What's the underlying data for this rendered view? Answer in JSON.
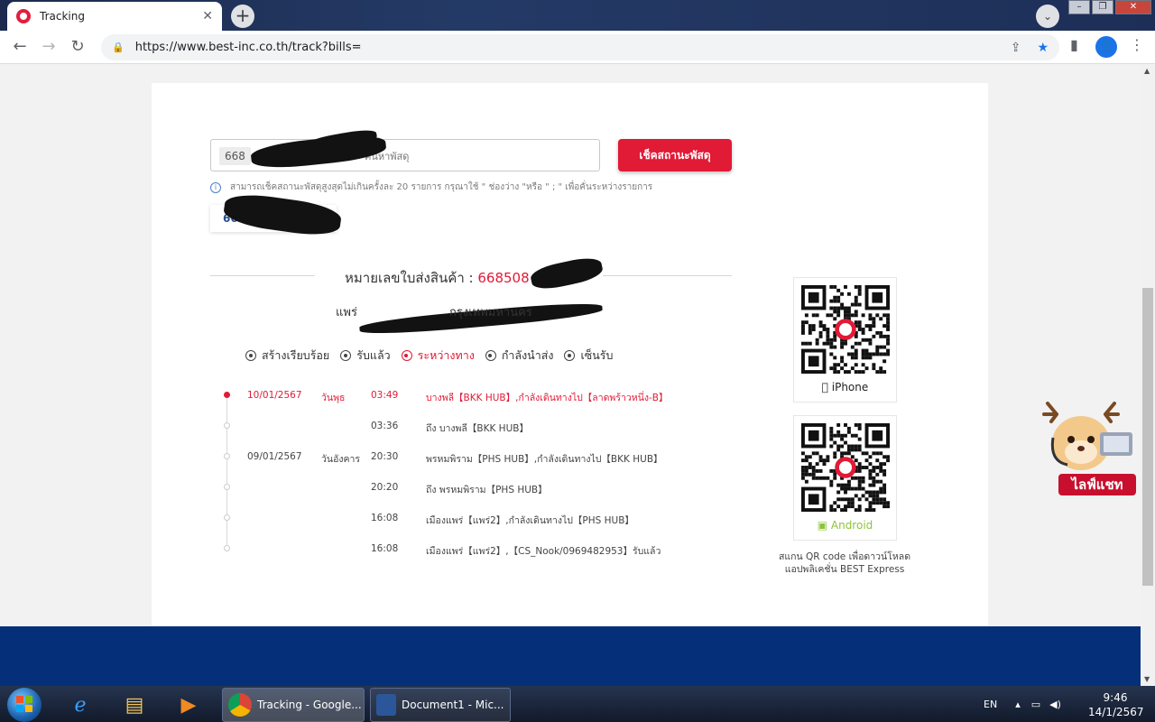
{
  "browser": {
    "tab_title": "Tracking",
    "url": "https://www.best-inc.co.th/track?bills="
  },
  "search": {
    "chip_text": "668",
    "placeholder": "ค้นหาพัสดุ",
    "button_label": "เช็คสถานะพัสดุ",
    "hint": "สามารถเช็คสถานะพัสดุสูงสุดไม่เกินครั้งละ 20 รายการ กรุณาใช้ \" ช่องว่าง \"หรือ \" ; \" เพื่อคั่นระหว่างรายการ",
    "history_text": "6685"
  },
  "shipment": {
    "waybill_label": "หมายเลขใบส่งสินค้า :",
    "waybill_number": "668508",
    "origin": "แพร่",
    "destination": "กรุงเทพมหานคร"
  },
  "steps": [
    {
      "label": "สร้างเรียบร้อย",
      "active": false
    },
    {
      "label": "รับแล้ว",
      "active": false
    },
    {
      "label": "ระหว่างทาง",
      "active": true
    },
    {
      "label": "กำลังนำส่ง",
      "active": false
    },
    {
      "label": "เซ็นรับ",
      "active": false
    }
  ],
  "events": [
    {
      "date": "10/01/2567",
      "day": "วันพุธ",
      "time": "03:49",
      "desc": "บางพลี【BKK HUB】,กำลังเดินทางไป【ลาดพร้าวหนึ่ง-B】"
    },
    {
      "date": "",
      "day": "",
      "time": "03:36",
      "desc": "ถึง บางพลี【BKK HUB】"
    },
    {
      "date": "09/01/2567",
      "day": "วันอังคาร",
      "time": "20:30",
      "desc": "พรหมพิราม【PHS HUB】,กำลังเดินทางไป【BKK HUB】"
    },
    {
      "date": "",
      "day": "",
      "time": "20:20",
      "desc": "ถึง พรหมพิราม【PHS HUB】"
    },
    {
      "date": "",
      "day": "",
      "time": "16:08",
      "desc": "เมืองแพร่【แพร่2】,กำลังเดินทางไป【PHS HUB】"
    },
    {
      "date": "",
      "day": "",
      "time": "16:08",
      "desc": "เมืองแพร่【แพร่2】,【CS_Nook/0969482953】รับแล้ว"
    }
  ],
  "apps": {
    "ios_label": "iPhone",
    "android_label": "Android",
    "caption_line1": "สแกน QR code เพื่อดาวน์โหลด",
    "caption_line2": "แอปพลิเคชั่น BEST Express"
  },
  "chat": {
    "label": "ไลฟ์แชท"
  },
  "taskbar": {
    "tasks": [
      "Tracking - Google...",
      "Document1 - Mic..."
    ],
    "lang": "EN",
    "time": "9:46",
    "date": "14/1/2567"
  },
  "colors": {
    "brand_red": "#e11a36",
    "footer_navy": "#062f7a",
    "android_green": "#8dc23c"
  }
}
